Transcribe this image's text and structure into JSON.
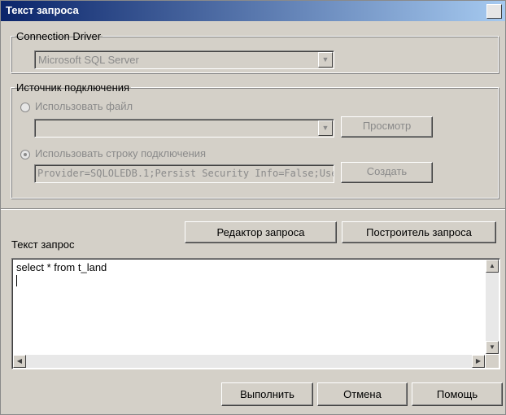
{
  "window": {
    "title": "Текст запроса"
  },
  "connection_driver": {
    "legend": "Connection Driver",
    "selected": "Microsoft SQL Server"
  },
  "source": {
    "legend": "Источник подключения",
    "use_file_label": "Использовать файл",
    "file_value": "",
    "browse_button": "Просмотр",
    "use_string_label": "Использовать строку подключения",
    "connection_string": "Provider=SQLOLEDB.1;Persist Security Info=False;User II",
    "create_button": "Создать"
  },
  "query": {
    "editor_button": "Редактор запроса",
    "builder_button": "Построитель запроса",
    "label": "Текст запрос",
    "text": "select * from t_land"
  },
  "footer": {
    "run_button": "Выполнить",
    "cancel_button": "Отмена",
    "help_button": "Помощь"
  }
}
